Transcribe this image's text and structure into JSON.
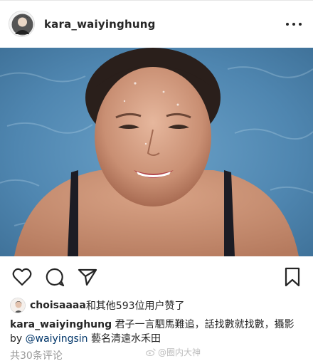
{
  "post": {
    "username": "kara_waiyinghung"
  },
  "likes": {
    "user": "choisaaaa",
    "rest": "和其他593位用户赞了"
  },
  "caption": {
    "user": "kara_waiyinghung",
    "text_1": " 君子一言駟馬難追，話找數就找數，攝影by ",
    "mention": "@waiyingsin",
    "text_2": " 藝名清遠水禾田"
  },
  "comments": {
    "label": "共30条评论"
  },
  "watermark": {
    "text": "@圈内大神"
  },
  "icons": {
    "more": "more-options-icon",
    "like": "heart-icon",
    "comment": "comment-icon",
    "share": "paper-plane-icon",
    "save": "bookmark-icon"
  },
  "colors": {
    "text": "#262626",
    "mention": "#003569",
    "muted": "#999999",
    "pool": "#4f86b0"
  }
}
